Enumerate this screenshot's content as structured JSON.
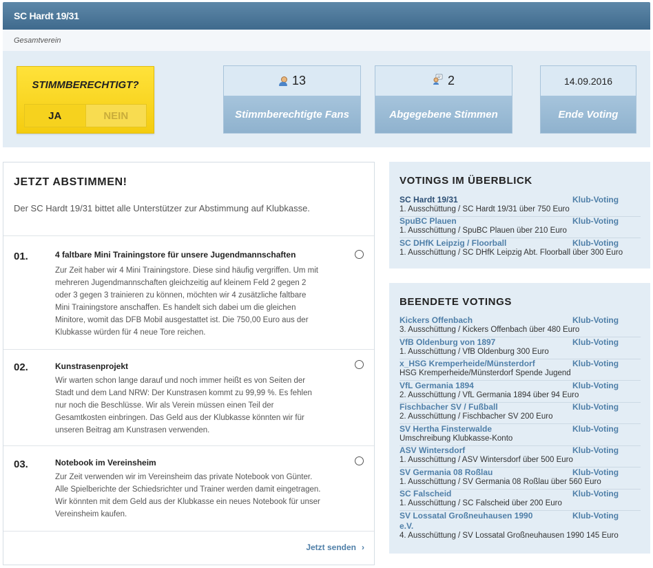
{
  "header": {
    "title": "SC Hardt 19/31",
    "subtitle": "Gesamtverein"
  },
  "stats": {
    "question": "STIMMBERECHTIGT?",
    "yes": "JA",
    "no": "NEIN",
    "fans_count": "13",
    "fans_label": "Stimmberechtigte Fans",
    "votes_count": "2",
    "votes_label": "Abgegebene Stimmen",
    "end_date": "14.09.2016",
    "end_label": "Ende Voting"
  },
  "vote": {
    "heading": "JETZT ABSTIMMEN!",
    "intro": "Der SC Hardt 19/31 bittet alle Unterstützer zur Abstimmung auf Klubkasse.",
    "items": [
      {
        "num": "01.",
        "title": "4 faltbare Mini Trainingstore für unsere Jugendmannschaften",
        "lines": [
          "Zur Zeit haber wir 4 Mini Trainingstore. Diese sind häufig vergriffen. Um mit",
          "mehreren Jugendmannschaften gleichzeitig auf kleinem Feld 2 gegen 2",
          "oder 3 gegen 3 trainieren zu können, möchten wir 4 zusätzliche faltbare",
          "Mini Trainingstore anschaffen. Es handelt sich dabei um die gleichen",
          "Minitore, womit das DFB Mobil ausgestattet ist. Die 750,00 Euro aus der",
          "Klubkasse würden für 4 neue Tore reichen."
        ]
      },
      {
        "num": "02.",
        "title": "Kunstrasenprojekt",
        "lines": [
          "Wir warten schon lange darauf und noch immer heißt es von Seiten der",
          "Stadt und dem Land NRW: Der Kunstrasen kommt zu 99,99 %. Es fehlen",
          "nur noch die Beschlüsse. Wir als Verein müssen einen Teil der",
          "Gesamtkosten einbringen. Das Geld aus der Klubkasse könnten wir für",
          "unseren Beitrag am Kunstrasen verwenden."
        ]
      },
      {
        "num": "03.",
        "title": "Notebook im Vereinsheim",
        "lines": [
          "Zur Zeit verwenden wir im Vereinsheim das private Notebook von Günter.",
          "Alle Spielberichte der Schiedsrichter und Trainer werden damit eingetragen.",
          "Wir könnten mit dem Geld aus der Klubkasse ein neues Notebook für unser",
          "Vereinsheim kaufen."
        ]
      }
    ],
    "send": "Jetzt senden",
    "send_icon": "chevron-right-icon"
  },
  "overview": {
    "heading": "VOTINGS IM ÜBERBLICK",
    "rows": [
      {
        "club": "SC Hardt 19/31",
        "type": "Klub-Voting",
        "desc": "1. Ausschüttung / SC Hardt 19/31 über 750 Euro"
      },
      {
        "club": "SpuBC Plauen",
        "type": "Klub-Voting",
        "desc": "1. Ausschüttung / SpuBC Plauen über 210 Euro"
      },
      {
        "club": "SC DHfK Leipzig / Floorball",
        "type": "Klub-Voting",
        "desc": "1. Ausschüttung / SC DHfK Leipzig Abt. Floorball über 300 Euro"
      }
    ]
  },
  "finished": {
    "heading": "BEENDETE VOTINGS",
    "rows": [
      {
        "club": "Kickers Offenbach",
        "type": "Klub-Voting",
        "desc": "3. Ausschüttung / Kickers Offenbach über 480 Euro"
      },
      {
        "club": "VfB Oldenburg von 1897",
        "type": "Klub-Voting",
        "desc": "1. Ausschüttung / VfB Oldenburg 300 Euro"
      },
      {
        "club": "x_HSG Kremperheide/Münsterdorf",
        "type": "Klub-Voting",
        "desc": "HSG Kremperheide/Münsterdorf Spende Jugend"
      },
      {
        "club": "VfL Germania 1894",
        "type": "Klub-Voting",
        "desc": "2. Ausschüttung / VfL Germania 1894 über 94 Euro"
      },
      {
        "club": "Fischbacher SV / Fußball",
        "type": "Klub-Voting",
        "desc": "2. Ausschüttung / Fischbacher SV 200 Euro"
      },
      {
        "club": "SV Hertha Finsterwalde",
        "type": "Klub-Voting",
        "desc": "Umschreibung Klubkasse-Konto"
      },
      {
        "club": "ASV Wintersdorf",
        "type": "Klub-Voting",
        "desc": "1. Ausschüttung / ASV Wintersdorf über 500 Euro"
      },
      {
        "club": "SV Germania 08 Roßlau",
        "type": "Klub-Voting",
        "desc": "1. Ausschüttung / SV Germania 08 Roßlau über 560 Euro"
      },
      {
        "club": "SC Falscheid",
        "type": "Klub-Voting",
        "desc": "1. Ausschüttung / SC Falscheid über 200 Euro"
      },
      {
        "club": "SV Lossatal Großneuhausen 1990 e.V.",
        "type": "Klub-Voting",
        "desc": "4. Ausschüttung / SV Lossatal Großneuhausen 1990 145 Euro"
      }
    ]
  }
}
